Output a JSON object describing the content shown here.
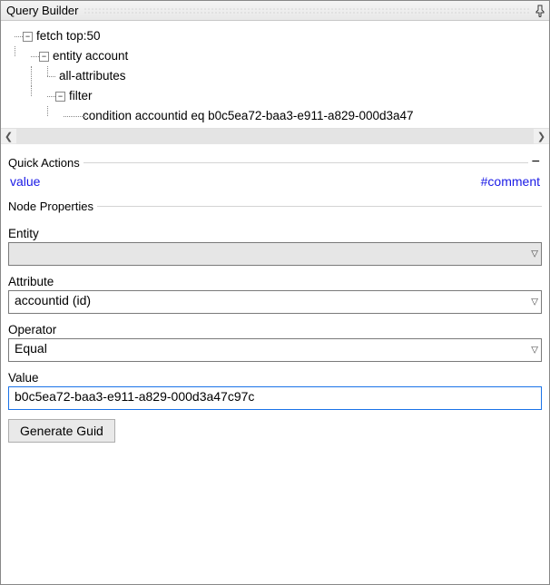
{
  "title": "Query Builder",
  "tree": {
    "nodes": [
      "fetch top:50",
      "entity account",
      "all-attributes",
      "filter",
      "condition accountid eq b0c5ea72-baa3-e911-a829-000d3a47"
    ]
  },
  "quick_actions": {
    "title": "Quick Actions",
    "value_link": "value",
    "comment_link": "#comment"
  },
  "node_properties": {
    "title": "Node Properties",
    "entity_label": "Entity",
    "entity_value": "",
    "attribute_label": "Attribute",
    "attribute_value": "accountid (id)",
    "operator_label": "Operator",
    "operator_value": "Equal",
    "value_label": "Value",
    "value_value": "b0c5ea72-baa3-e911-a829-000d3a47c97c",
    "generate_guid_label": "Generate Guid"
  }
}
